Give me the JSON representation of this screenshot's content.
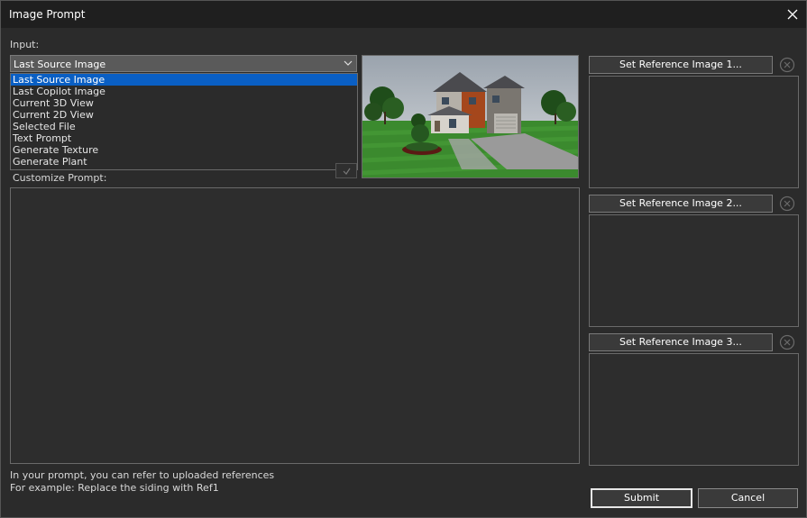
{
  "window": {
    "title": "Image Prompt"
  },
  "input": {
    "label": "Input:",
    "selected": "Last Source Image",
    "options": [
      "Last Source Image",
      "Last Copilot Image",
      "Current 3D View",
      "Current 2D View",
      "Selected File",
      "Text Prompt",
      "Generate Texture",
      "Generate Plant"
    ]
  },
  "prompt": {
    "label": "Customize Prompt:",
    "value": ""
  },
  "references": [
    {
      "button_label": "Set Reference Image 1..."
    },
    {
      "button_label": "Set Reference Image 2..."
    },
    {
      "button_label": "Set Reference Image 3..."
    }
  ],
  "help": {
    "line1": "In your prompt, you can refer to uploaded references",
    "line2": "For example: Replace the siding with Ref1"
  },
  "buttons": {
    "submit": "Submit",
    "cancel": "Cancel"
  },
  "colors": {
    "selection": "#0a5fc4",
    "background": "#2b2b2b",
    "titlebar": "#1f1f1f"
  }
}
